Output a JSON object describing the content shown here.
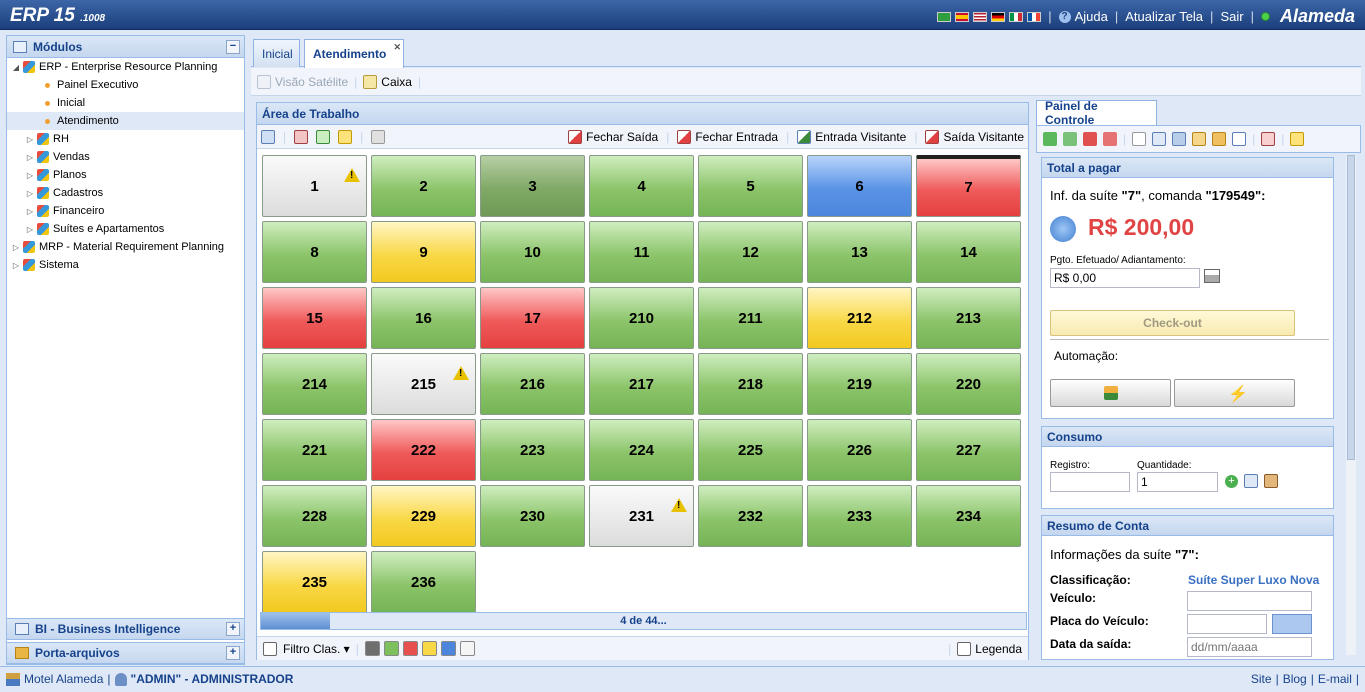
{
  "header": {
    "logo": "ERP 15",
    "version": ".1008",
    "links": [
      "Ajuda",
      "Atualizar Tela",
      "Sair"
    ],
    "brand": "Alameda",
    "flags": [
      "#2e9e3e",
      "#c8102e",
      "#3c3b6e",
      "#000000",
      "#009246",
      "#0055a4"
    ]
  },
  "sidebar": {
    "title": "Módulos",
    "items": [
      {
        "label": "ERP - Enterprise Resource Planning",
        "level": 0,
        "type": "cube",
        "expanded": true
      },
      {
        "label": "Painel Executivo",
        "level": 1,
        "type": "dot"
      },
      {
        "label": "Inicial",
        "level": 1,
        "type": "dot"
      },
      {
        "label": "Atendimento",
        "level": 1,
        "type": "dot",
        "selected": true
      },
      {
        "label": "RH",
        "level": 1,
        "type": "cube"
      },
      {
        "label": "Vendas",
        "level": 1,
        "type": "cube"
      },
      {
        "label": "Planos",
        "level": 1,
        "type": "cube"
      },
      {
        "label": "Cadastros",
        "level": 1,
        "type": "cube"
      },
      {
        "label": "Financeiro",
        "level": 1,
        "type": "cube"
      },
      {
        "label": "Suítes e Apartamentos",
        "level": 1,
        "type": "cube"
      },
      {
        "label": "MRP - Material Requirement Planning",
        "level": 0,
        "type": "cube"
      },
      {
        "label": "Sistema",
        "level": 0,
        "type": "cube"
      }
    ],
    "bi_title": "BI - Business Intelligence",
    "porta_title": "Porta-arquivos"
  },
  "tabs": {
    "inicial": "Inicial",
    "atendimento": "Atendimento"
  },
  "subtoolbar": {
    "visao": "Visão Satélite",
    "caixa": "Caixa"
  },
  "work": {
    "title": "Área de Trabalho",
    "fechar_saida": "Fechar Saída",
    "fechar_entrada": "Fechar Entrada",
    "entrada_visitante": "Entrada Visitante",
    "saida_visitante": "Saída Visitante",
    "tiles": [
      {
        "n": "1",
        "c": "w",
        "warn": true
      },
      {
        "n": "2",
        "c": "g"
      },
      {
        "n": "3",
        "c": "dg"
      },
      {
        "n": "4",
        "c": "g"
      },
      {
        "n": "5",
        "c": "g"
      },
      {
        "n": "6",
        "c": "b"
      },
      {
        "n": "7",
        "c": "r"
      },
      {
        "n": "8",
        "c": "g"
      },
      {
        "n": "9",
        "c": "y"
      },
      {
        "n": "10",
        "c": "g"
      },
      {
        "n": "11",
        "c": "g"
      },
      {
        "n": "12",
        "c": "g"
      },
      {
        "n": "13",
        "c": "g"
      },
      {
        "n": "14",
        "c": "g"
      },
      {
        "n": "15",
        "c": "r"
      },
      {
        "n": "16",
        "c": "g"
      },
      {
        "n": "17",
        "c": "r"
      },
      {
        "n": "210",
        "c": "g"
      },
      {
        "n": "211",
        "c": "g"
      },
      {
        "n": "212",
        "c": "y"
      },
      {
        "n": "213",
        "c": "g"
      },
      {
        "n": "214",
        "c": "g"
      },
      {
        "n": "215",
        "c": "w",
        "warn": true
      },
      {
        "n": "216",
        "c": "g"
      },
      {
        "n": "217",
        "c": "g"
      },
      {
        "n": "218",
        "c": "g"
      },
      {
        "n": "219",
        "c": "g"
      },
      {
        "n": "220",
        "c": "g"
      },
      {
        "n": "221",
        "c": "g"
      },
      {
        "n": "222",
        "c": "r"
      },
      {
        "n": "223",
        "c": "g"
      },
      {
        "n": "224",
        "c": "g"
      },
      {
        "n": "225",
        "c": "g"
      },
      {
        "n": "226",
        "c": "g"
      },
      {
        "n": "227",
        "c": "g"
      },
      {
        "n": "228",
        "c": "g"
      },
      {
        "n": "229",
        "c": "y"
      },
      {
        "n": "230",
        "c": "g"
      },
      {
        "n": "231",
        "c": "w",
        "warn": true
      },
      {
        "n": "232",
        "c": "g"
      },
      {
        "n": "233",
        "c": "g"
      },
      {
        "n": "234",
        "c": "g"
      },
      {
        "n": "235",
        "c": "y"
      },
      {
        "n": "236",
        "c": "g"
      }
    ],
    "pager": "4 de 44...",
    "pager_progress": 0.09,
    "filter": "Filtro Clas.",
    "legend": "Legenda",
    "swatches": [
      "#6e6e6e",
      "#7fc05e",
      "#e85050",
      "#f9d847",
      "#4c86dc",
      "#f5f5f5"
    ]
  },
  "control": {
    "tab": "Painel de Controle",
    "total_title": "Total a pagar",
    "info_prefix": "Inf. da suíte ",
    "suite": "\"7\"",
    "info_mid": ", comanda ",
    "comanda": "\"179549\":",
    "amount": "R$ 200,00",
    "pgto_label": "Pgto. Efetuado/ Adiantamento:",
    "pgto_value": "R$ 0,00",
    "checkout": "Check-out",
    "automacao": "Automação:",
    "consumo_title": "Consumo",
    "registro_label": "Registro:",
    "quantidade_label": "Quantidade:",
    "quantidade_value": "1",
    "resumo_title": "Resumo de Conta",
    "resumo_info": "Informações da suíte ",
    "resumo_suite": "\"7\":",
    "classificacao_label": "Classificação:",
    "classificacao_value": "Suíte Super Luxo Nova",
    "veiculo_label": "Veículo:",
    "placa_label": "Placa do Veículo:",
    "data_label": "Data da saída:",
    "data_placeholder": "dd/mm/aaaa"
  },
  "footer": {
    "company": "Motel Alameda",
    "user": "\"ADMIN\" - ADMINISTRADOR",
    "links": [
      "Site",
      "Blog",
      "E-mail"
    ]
  }
}
